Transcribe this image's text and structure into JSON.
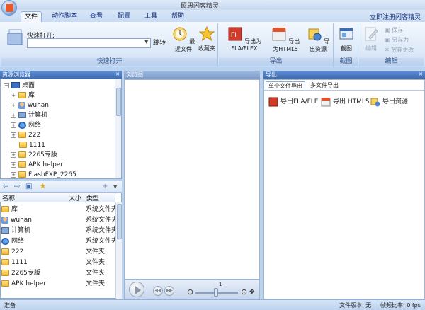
{
  "window": {
    "title": "硕思闪客精灵"
  },
  "menu": {
    "tabs": [
      "文件",
      "动作脚本",
      "查看",
      "配置",
      "工具",
      "帮助"
    ],
    "active": "文件",
    "register_link": "立即注册闪客精灵"
  },
  "ribbon": {
    "quick_open": {
      "label": "快速打开:",
      "value": "",
      "jump_label": "跳转",
      "recent_label": "最近文件",
      "favorites_label": "收藏夹",
      "group_label": "快速打开"
    },
    "export": {
      "fla_label": "导出为FLA/FLEX",
      "html5_label": "导出为HTML5",
      "resource_label": "导出资源",
      "group_label": "导出"
    },
    "screenshot": {
      "button_label": "截图",
      "group_label": "截图"
    },
    "edit": {
      "edit_label": "编辑",
      "save_label": "保存",
      "save_as_label": "另存为",
      "discard_label": "放弃更改",
      "group_label": "编辑"
    }
  },
  "explorer": {
    "title": "资源浏览器",
    "tree": [
      {
        "label": "桌面",
        "icon": "desktop-icon",
        "depth": 0
      },
      {
        "label": "库",
        "icon": "library-icon",
        "depth": 1
      },
      {
        "label": "wuhan",
        "icon": "user-folder-icon",
        "depth": 1
      },
      {
        "label": "计算机",
        "icon": "computer-icon",
        "depth": 1
      },
      {
        "label": "网络",
        "icon": "network-icon",
        "depth": 1
      },
      {
        "label": "222",
        "icon": "folder-icon",
        "depth": 1
      },
      {
        "label": "1111",
        "icon": "folder-icon",
        "depth": 1
      },
      {
        "label": "2265专版",
        "icon": "folder-icon",
        "depth": 1
      },
      {
        "label": "APK helper",
        "icon": "folder-icon",
        "depth": 1
      },
      {
        "label": "FlashFXP_2265",
        "icon": "folder-icon",
        "depth": 1
      }
    ],
    "columns": {
      "name": "名称",
      "size": "大小",
      "type": "类型"
    },
    "files": [
      {
        "name": "库",
        "type": "系统文件夹"
      },
      {
        "name": "wuhan",
        "type": "系统文件夹"
      },
      {
        "name": "计算机",
        "type": "系统文件夹"
      },
      {
        "name": "网络",
        "type": "系统文件夹"
      },
      {
        "name": "222",
        "type": "文件夹"
      },
      {
        "name": "1111",
        "type": "文件夹"
      },
      {
        "name": "2265专版",
        "type": "文件夹"
      },
      {
        "name": "APK helper",
        "type": "文件夹"
      }
    ]
  },
  "preview": {
    "title": "浏览图",
    "zoom_dots": "1"
  },
  "export_panel": {
    "title": "导出",
    "tabs": [
      "单个文件导出",
      "多文件导出"
    ],
    "buttons": [
      "导出FLA/FLE",
      "导出 HTML5",
      "导出资源"
    ]
  },
  "statusbar": {
    "ready": "准备",
    "file_version": "文件版本: 无",
    "frame_rate": "帧频比率: 0 fps"
  },
  "colors": {
    "accent": "#3d6cb4",
    "ribbon_bg": "#dbe8f8",
    "folder": "#f0b932"
  }
}
